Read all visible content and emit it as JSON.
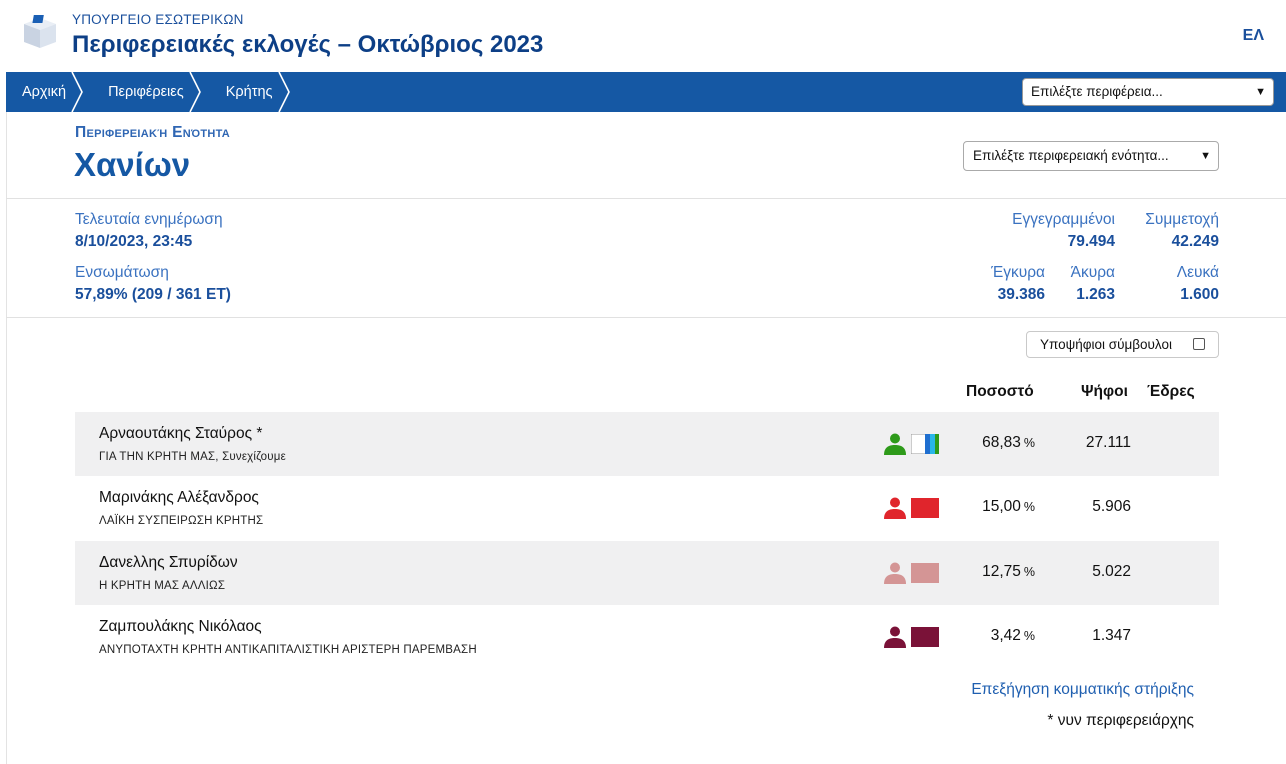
{
  "header": {
    "ministry": "ΥΠΟΥΡΓΕΙΟ ΕΣΩΤΕΡΙΚΩΝ",
    "title": "Περιφερειακές εκλογές – Οκτώβριος 2023",
    "language": "ΕΛ"
  },
  "nav": {
    "crumbs": [
      "Αρχική",
      "Περιφέρειες",
      "Κρήτης"
    ],
    "region_select": "Επιλέξτε περιφέρεια..."
  },
  "unit": {
    "kicker": "Περιφερειακή Ενότητα",
    "name": "Χανίων",
    "unit_select": "Επιλέξτε περιφερειακή ενότητα..."
  },
  "stats": {
    "last_update_label": "Τελευταία ενημέρωση",
    "last_update_value": "8/10/2023, 23:45",
    "integration_label": "Ενσωμάτωση",
    "integration_value": "57,89% (209 / 361 ΕΤ)",
    "registered_label": "Εγγεγραμμένοι",
    "registered_value": "79.494",
    "turnout_label": "Συμμετοχή",
    "turnout_value": "42.249",
    "valid_label": "Έγκυρα",
    "valid_value": "39.386",
    "invalid_label": "Άκυρα",
    "invalid_value": "1.263",
    "blank_label": "Λευκά",
    "blank_value": "1.600"
  },
  "candidates_toggle": {
    "label": "Υποψήφιοι σύμβουλοι",
    "checked": false
  },
  "table": {
    "headers": {
      "percent": "Ποσοστό",
      "votes": "Ψήφοι",
      "seats": "Έδρες"
    },
    "percent_unit": "%",
    "rows": [
      {
        "name": "Αρναουτάκης Σταύρος *",
        "party": "ΓΙΑ ΤΗΝ ΚΡΗΤΗ ΜΑΣ, Συνεχίζουμε",
        "percent": "68,83",
        "votes": "27.111",
        "seats": "",
        "color": "#2e9a1a",
        "icon": "person-icon",
        "flag": "multicolor-flag"
      },
      {
        "name": "Μαρινάκης Αλέξανδρος",
        "party": "ΛΑΪΚΗ ΣΥΣΠΕΙΡΩΣΗ ΚΡΗΤΗΣ",
        "percent": "15,00",
        "votes": "5.906",
        "seats": "",
        "color": "#e0252c",
        "icon": "person-icon",
        "flag": "red-flag"
      },
      {
        "name": "Δανελλης Σπυρίδων",
        "party": "Η ΚΡΗΤΗ ΜΑΣ ΑΛΛΙΩΣ",
        "percent": "12,75",
        "votes": "5.022",
        "seats": "",
        "color": "#d49595",
        "icon": "person-icon",
        "flag": "pink-flag"
      },
      {
        "name": "Ζαμπουλάκης Νικόλαος",
        "party": "ΑΝΥΠΟΤΑΧΤΗ ΚΡΗΤΗ ΑΝΤΙΚΑΠΙΤΑΛΙΣΤΙΚΗ ΑΡΙΣΤΕΡΗ ΠΑΡΕΜΒΑΣΗ",
        "percent": "3,42",
        "votes": "1.347",
        "seats": "",
        "color": "#7a1238",
        "icon": "person-icon",
        "flag": "maroon-flag"
      }
    ]
  },
  "footer": {
    "explanation_link": "Επεξήγηση κομματικής στήριξης",
    "note": "* νυν περιφερειάρχης"
  },
  "colors": {
    "brand_blue": "#1558a4",
    "title_blue": "#0d3f86",
    "row_shade": "#f0f0f1"
  }
}
